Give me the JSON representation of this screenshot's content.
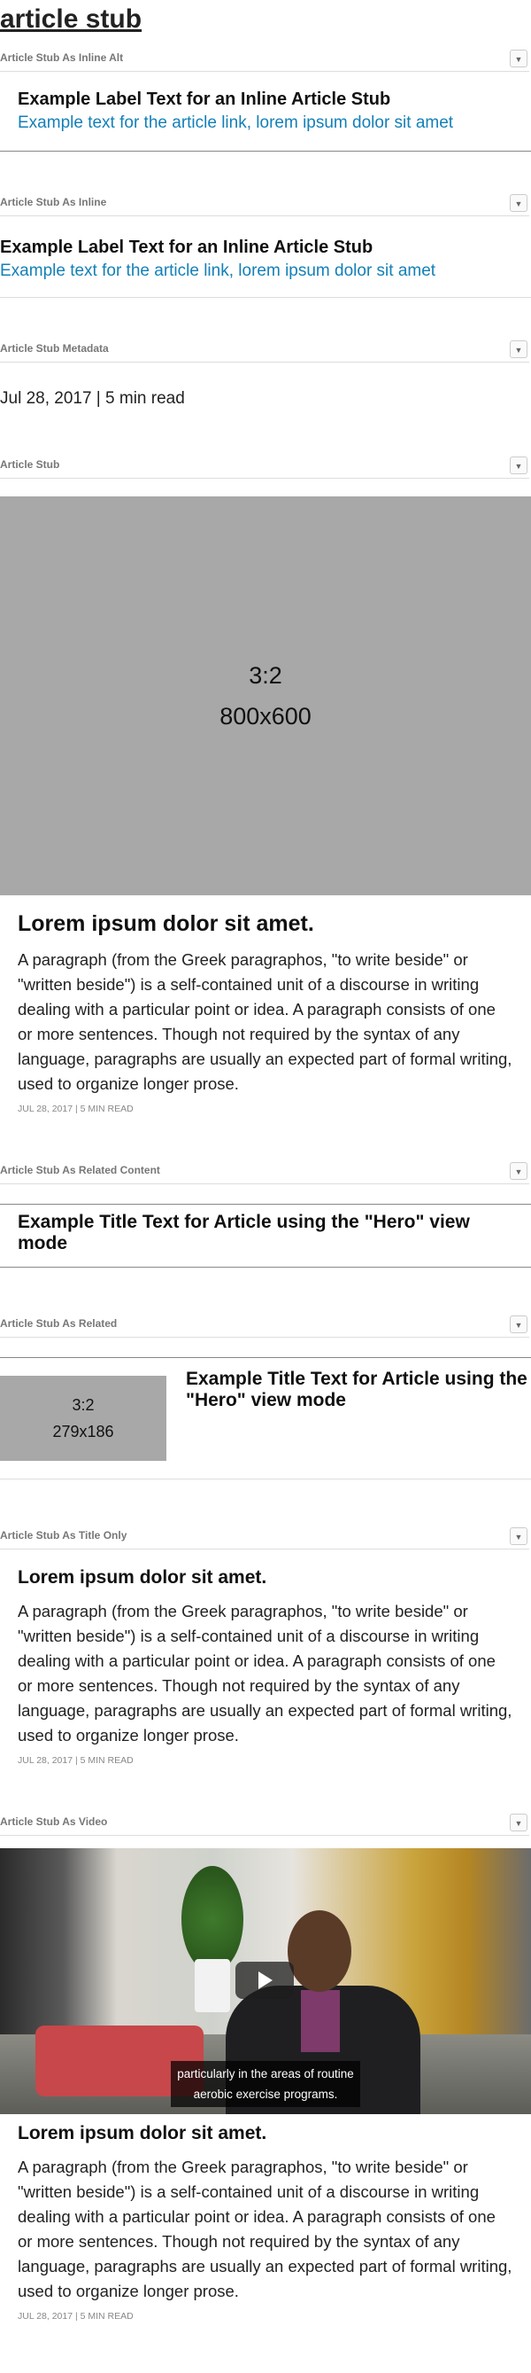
{
  "page": {
    "title": "article stub"
  },
  "toggle_glyph": "▼",
  "sections": {
    "inline_alt": {
      "header": "Article Stub As Inline Alt",
      "label": "Example Label Text for an Inline Article Stub",
      "link": "Example text for the article link, lorem ipsum dolor sit amet"
    },
    "inline": {
      "header": "Article Stub As Inline",
      "label": "Example Label Text for an Inline Article Stub",
      "link": "Example text for the article link, lorem ipsum dolor sit amet"
    },
    "metadata": {
      "header": "Article Stub Metadata",
      "text": "Jul 28, 2017 | 5 min read"
    },
    "stub": {
      "header": "Article Stub",
      "image_ratio": "3:2",
      "image_size": "800x600",
      "title": "Lorem ipsum dolor sit amet.",
      "paragraph": "A paragraph (from the Greek paragraphos, \"to write beside\" or \"written beside\") is a self-contained unit of a discourse in writing dealing with a particular point or idea. A paragraph consists of one or more sentences. Though not required by the syntax of any language, paragraphs are usually an expected part of formal writing, used to organize longer prose.",
      "meta": "JUL 28, 2017 | 5 MIN READ"
    },
    "related_content": {
      "header": "Article Stub As Related Content",
      "title": "Example Title Text for Article using the \"Hero\" view mode"
    },
    "related": {
      "header": "Article Stub As Related",
      "image_ratio": "3:2",
      "image_size": "279x186",
      "title": "Example Title Text for Article using the \"Hero\" view mode"
    },
    "title_only": {
      "header": "Article Stub As Title Only",
      "title": "Lorem ipsum dolor sit amet.",
      "paragraph": "A paragraph (from the Greek paragraphos, \"to write beside\" or \"written beside\") is a self-contained unit of a discourse in writing dealing with a particular point or idea. A paragraph consists of one or more sentences. Though not required by the syntax of any language, paragraphs are usually an expected part of formal writing, used to organize longer prose.",
      "meta": "JUL 28, 2017 | 5 MIN READ"
    },
    "video": {
      "header": "Article Stub As Video",
      "caption_line1": "particularly in the areas of routine",
      "caption_line2": "aerobic exercise programs.",
      "title": "Lorem ipsum dolor sit amet.",
      "paragraph": "A paragraph (from the Greek paragraphos, \"to write beside\" or \"written beside\") is a self-contained unit of a discourse in writing dealing with a particular point or idea. A paragraph consists of one or more sentences. Though not required by the syntax of any language, paragraphs are usually an expected part of formal writing, used to organize longer prose.",
      "meta": "JUL 28, 2017 | 5 MIN READ"
    }
  },
  "colors": {
    "link": "#1380b8",
    "placeholder_bg": "#a8a8a8",
    "header_label": "#777777"
  }
}
